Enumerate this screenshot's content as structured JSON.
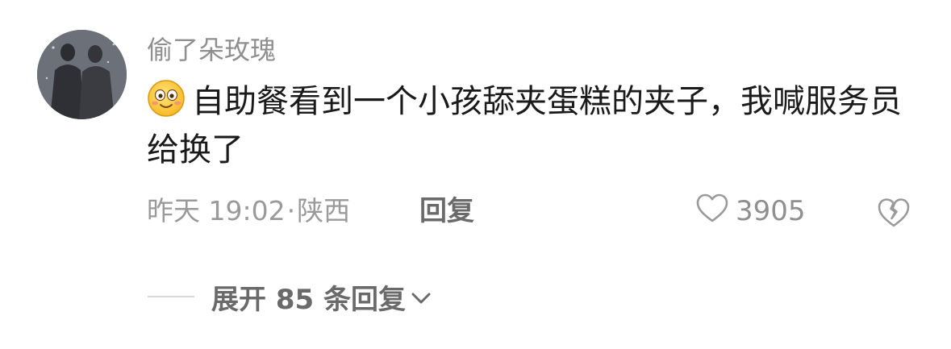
{
  "comment": {
    "username": "偷了朵玫瑰",
    "emoji": "smiley-emoji",
    "text": "自助餐看到一个小孩舔夹蛋糕的夹子，我喊服务员给换了",
    "time": "昨天 19:02",
    "separator": "·",
    "location": "陕西",
    "reply_label": "回复",
    "like_count": "3905",
    "like_icon": "heart-outline-icon",
    "dislike_icon": "broken-heart-icon"
  },
  "expand": {
    "label": "展开 85 条回复",
    "icon": "chevron-down-icon"
  },
  "colors": {
    "text_primary": "#1a1a1a",
    "text_secondary": "#9a9a9a",
    "text_action": "#6a6a6a",
    "divider": "#d9d9d9"
  }
}
